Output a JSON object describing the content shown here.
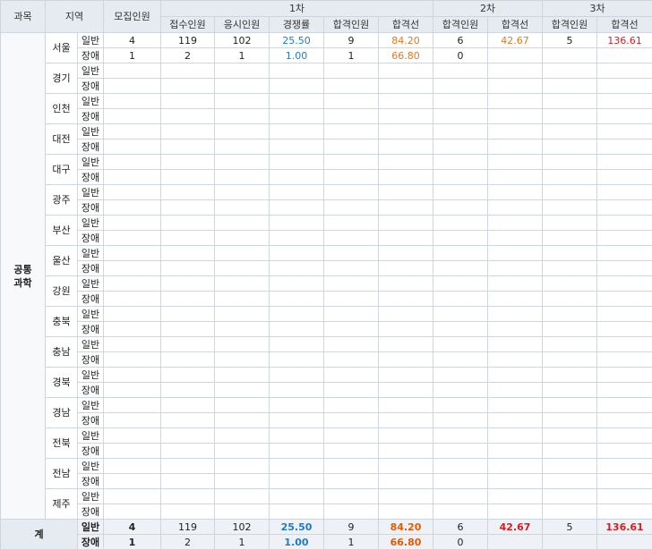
{
  "headers": {
    "subject": "과목",
    "region": "지역",
    "quota": "모집인원",
    "stage1": "1차",
    "stage2": "2차",
    "stage3": "3차",
    "applicants": "접수인원",
    "examinees": "응시인원",
    "competition": "경쟁률",
    "passers1": "합격인원",
    "cutoff1": "합격선",
    "passers2": "합격인원",
    "cutoff2": "합격선",
    "passers3": "합격인원",
    "cutoff3": "합격선"
  },
  "subject": "공통\n과학",
  "types": {
    "general": "일반",
    "disabled": "장애"
  },
  "regions": [
    {
      "name": "서울",
      "general": {
        "quota": "4",
        "applicants": "119",
        "examinees": "102",
        "competition": "25.50",
        "passers1": "9",
        "cutoff1": "84.20",
        "passers2": "6",
        "cutoff2": "42.67",
        "passers3": "5",
        "cutoff3": "136.61"
      },
      "disabled": {
        "quota": "1",
        "applicants": "2",
        "examinees": "1",
        "competition": "1.00",
        "passers1": "1",
        "cutoff1": "66.80",
        "passers2": "0",
        "cutoff2": "",
        "passers3": "",
        "cutoff3": ""
      }
    },
    {
      "name": "경기"
    },
    {
      "name": "인천"
    },
    {
      "name": "대전"
    },
    {
      "name": "대구"
    },
    {
      "name": "광주"
    },
    {
      "name": "부산"
    },
    {
      "name": "울산"
    },
    {
      "name": "강원"
    },
    {
      "name": "충북"
    },
    {
      "name": "충남"
    },
    {
      "name": "경북"
    },
    {
      "name": "경남"
    },
    {
      "name": "전북"
    },
    {
      "name": "전남"
    },
    {
      "name": "제주"
    }
  ],
  "total": {
    "label": "계",
    "general": {
      "quota": "4",
      "applicants": "119",
      "examinees": "102",
      "competition": "25.50",
      "passers1": "9",
      "cutoff1": "84.20",
      "passers2": "6",
      "cutoff2": "42.67",
      "passers3": "5",
      "cutoff3": "136.61"
    },
    "disabled": {
      "quota": "1",
      "applicants": "2",
      "examinees": "1",
      "competition": "1.00",
      "passers1": "1",
      "cutoff1": "66.80",
      "passers2": "0",
      "cutoff2": "",
      "passers3": "",
      "cutoff3": ""
    }
  },
  "colors": {
    "header_bg": "#e6ebf1",
    "grid": "#cfd5dd",
    "competition": "#1f7ac8",
    "cutoff1": "#e07a1f",
    "cutoff2": "#e07a1f",
    "cutoff3": "#d62020"
  }
}
